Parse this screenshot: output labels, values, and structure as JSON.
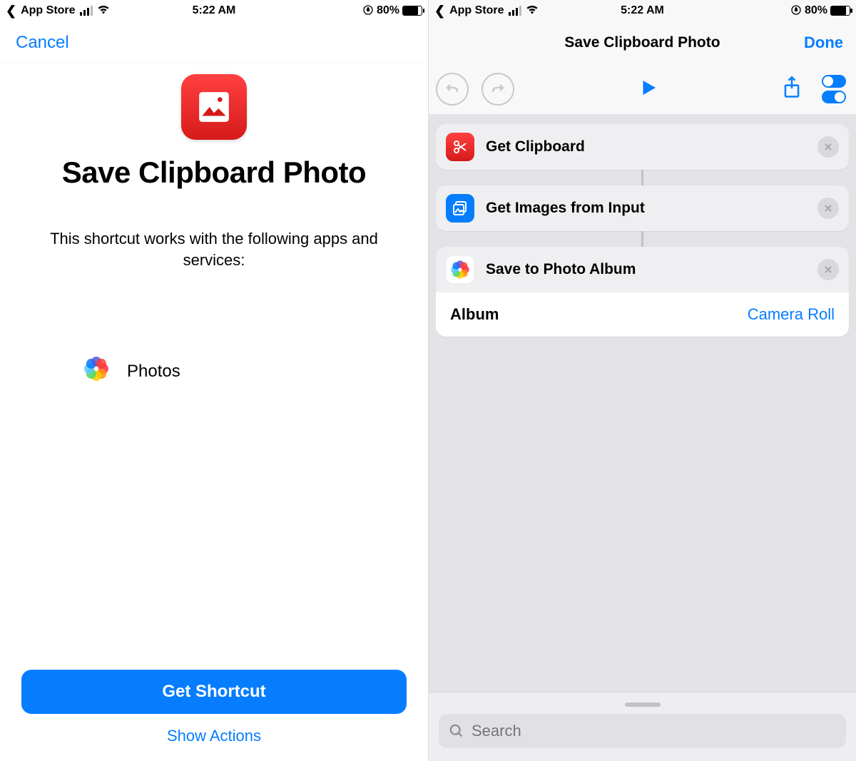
{
  "status": {
    "back_label": "App Store",
    "time": "5:22 AM",
    "battery_pct": "80%"
  },
  "left": {
    "cancel": "Cancel",
    "title": "Save Clipboard Photo",
    "description": "This shortcut works with the following apps and services:",
    "service": "Photos",
    "get_button": "Get Shortcut",
    "show_actions": "Show Actions"
  },
  "right": {
    "header_title": "Save Clipboard Photo",
    "done": "Done",
    "actions": {
      "get_clipboard": "Get Clipboard",
      "get_images": "Get Images from Input",
      "save_album": "Save to Photo Album"
    },
    "album_label": "Album",
    "album_value": "Camera Roll",
    "search_placeholder": "Search"
  }
}
